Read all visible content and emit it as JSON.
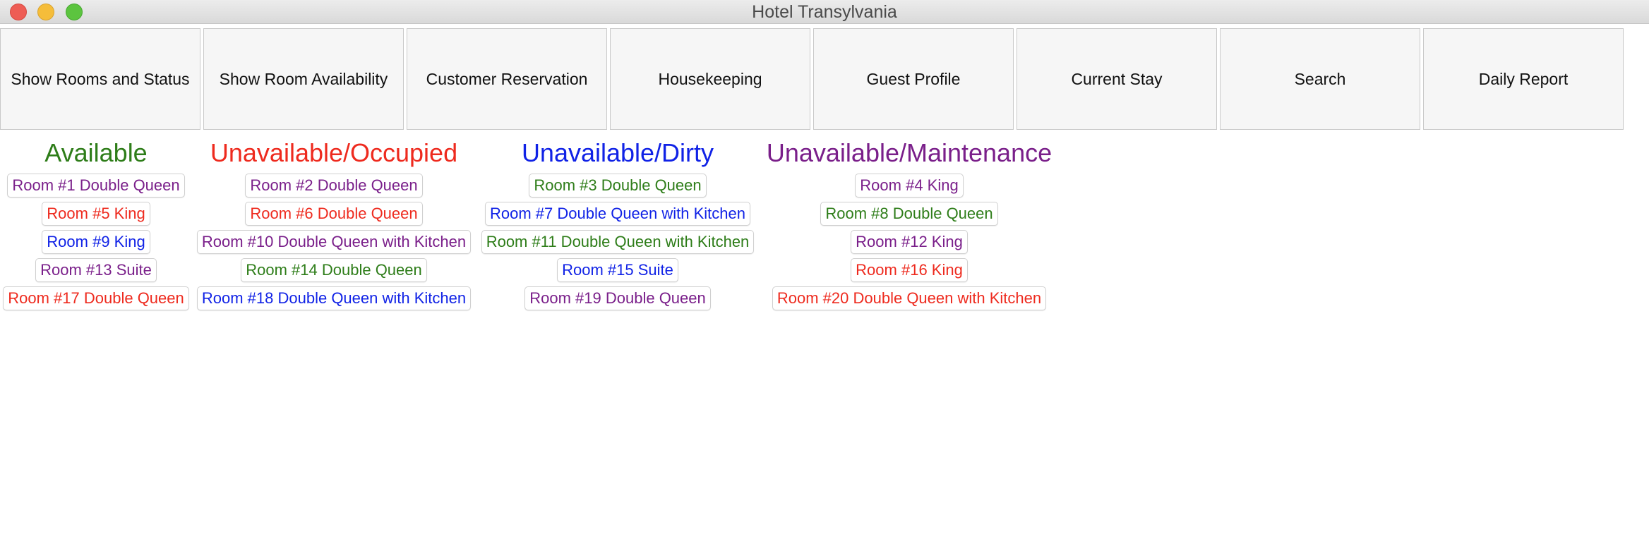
{
  "window": {
    "title": "Hotel Transylvania"
  },
  "toolbar": {
    "buttons": [
      {
        "label": "Show Rooms and Status"
      },
      {
        "label": "Show Room Availability"
      },
      {
        "label": "Customer Reservation"
      },
      {
        "label": "Housekeeping"
      },
      {
        "label": "Guest Profile"
      },
      {
        "label": "Current Stay"
      },
      {
        "label": "Search"
      },
      {
        "label": "Daily Report"
      }
    ]
  },
  "colors": {
    "purple": "#7a1f8a",
    "red": "#ee2a1e",
    "blue": "#1022e6",
    "green": "#2e7d19"
  },
  "columns": [
    {
      "header": "Available",
      "header_color": "green",
      "rooms": [
        {
          "label": "Room #1 Double Queen",
          "color": "purple"
        },
        {
          "label": "Room #5 King",
          "color": "red"
        },
        {
          "label": "Room #9 King",
          "color": "blue"
        },
        {
          "label": "Room #13 Suite",
          "color": "purple"
        },
        {
          "label": "Room #17 Double Queen",
          "color": "red"
        }
      ]
    },
    {
      "header": "Unavailable/Occupied",
      "header_color": "red",
      "rooms": [
        {
          "label": "Room #2 Double Queen",
          "color": "purple"
        },
        {
          "label": "Room #6 Double Queen",
          "color": "red"
        },
        {
          "label": "Room #10 Double Queen with Kitchen",
          "color": "purple"
        },
        {
          "label": "Room #14 Double Queen",
          "color": "green"
        },
        {
          "label": "Room #18 Double Queen with Kitchen",
          "color": "blue"
        }
      ]
    },
    {
      "header": "Unavailable/Dirty",
      "header_color": "blue",
      "rooms": [
        {
          "label": "Room #3 Double Queen",
          "color": "green"
        },
        {
          "label": "Room #7 Double Queen with Kitchen",
          "color": "blue"
        },
        {
          "label": "Room #11 Double Queen with Kitchen",
          "color": "green"
        },
        {
          "label": "Room #15 Suite",
          "color": "blue"
        },
        {
          "label": "Room #19 Double Queen",
          "color": "purple"
        }
      ]
    },
    {
      "header": "Unavailable/Maintenance",
      "header_color": "purple",
      "rooms": [
        {
          "label": "Room #4 King",
          "color": "purple"
        },
        {
          "label": "Room #8 Double Queen",
          "color": "green"
        },
        {
          "label": "Room #12 King",
          "color": "purple"
        },
        {
          "label": "Room #16 King",
          "color": "red"
        },
        {
          "label": "Room #20 Double Queen with Kitchen",
          "color": "red"
        }
      ]
    }
  ]
}
